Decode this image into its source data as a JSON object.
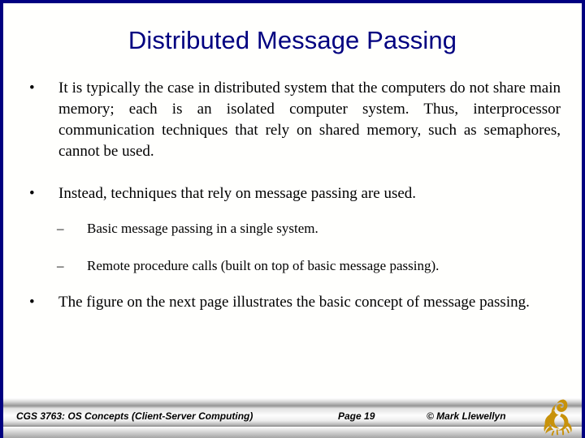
{
  "slide": {
    "title": "Distributed Message Passing",
    "accent_color": "#000080",
    "background_color": "#fffffd",
    "text_color": "#000000"
  },
  "content": {
    "bullets": [
      {
        "level": 1,
        "marker": "•",
        "text": "It is typically the case in distributed system that the computers do not share main memory; each is an isolated computer system.   Thus, interprocessor communication techniques that rely on shared memory, such as semaphores, cannot be used.",
        "align": "justify"
      },
      {
        "level": 1,
        "marker": "•",
        "text": "Instead, techniques that rely on message passing are used.",
        "align": "left"
      },
      {
        "level": 2,
        "marker": "–",
        "text": "Basic message passing in a single system.",
        "align": "left"
      },
      {
        "level": 2,
        "marker": "–",
        "text": "Remote procedure calls (built on top of basic message passing).",
        "align": "left"
      },
      {
        "level": 1,
        "marker": "•",
        "text": "The figure on the next page illustrates the basic concept of message passing.",
        "align": "left"
      }
    ]
  },
  "footer": {
    "course": "CGS 3763: OS Concepts  (Client-Server Computing)",
    "page": "Page 19",
    "credit": "© Mark Llewellyn",
    "logo_name": "ucf-pegasus-logo",
    "logo_color": "#c8920a"
  }
}
